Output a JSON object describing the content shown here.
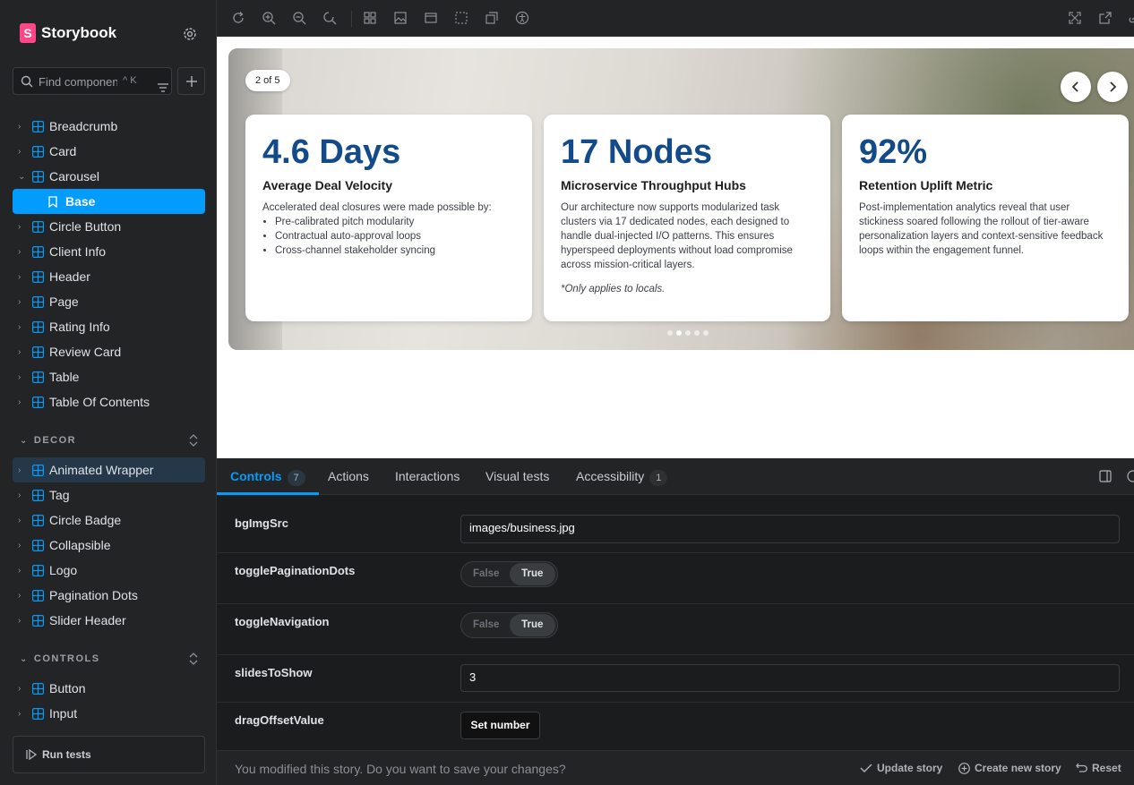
{
  "app": {
    "name": "Storybook"
  },
  "sidebar": {
    "search_placeholder": "Find components",
    "search_shortcut": "^ K",
    "components": [
      {
        "label": "Breadcrumb",
        "expanded": false
      },
      {
        "label": "Card",
        "expanded": false
      },
      {
        "label": "Carousel",
        "expanded": true
      },
      {
        "label": "Base",
        "story": true,
        "selected": true
      },
      {
        "label": "Circle Button",
        "expanded": false
      },
      {
        "label": "Client Info",
        "expanded": false
      },
      {
        "label": "Header",
        "expanded": false
      },
      {
        "label": "Page",
        "expanded": false
      },
      {
        "label": "Rating Info",
        "expanded": false
      },
      {
        "label": "Review Card",
        "expanded": false
      },
      {
        "label": "Table",
        "expanded": false
      },
      {
        "label": "Table Of Contents",
        "expanded": false
      }
    ],
    "decor_title": "DECOR",
    "decor": [
      {
        "label": "Animated Wrapper"
      },
      {
        "label": "Tag"
      },
      {
        "label": "Circle Badge"
      },
      {
        "label": "Collapsible"
      },
      {
        "label": "Logo"
      },
      {
        "label": "Pagination Dots"
      },
      {
        "label": "Slider Header"
      }
    ],
    "controls_title": "CONTROLS",
    "controls": [
      {
        "label": "Button"
      },
      {
        "label": "Input"
      }
    ],
    "run_tests_label": "Run tests"
  },
  "preview": {
    "counter": "2 of 5",
    "cards": [
      {
        "big": "4.6 Days",
        "title": "Average Deal Velocity",
        "desc": "Accelerated deal closures were made possible by:",
        "bullets": [
          "Pre-calibrated pitch modularity",
          "Contractual auto-approval loops",
          "Cross-channel stakeholder syncing"
        ]
      },
      {
        "big": "17 Nodes",
        "title": "Microservice Throughput Hubs",
        "desc": "Our architecture now supports modularized task clusters via 17 dedicated nodes, each designed to handle dual-injected I/O patterns. This ensures hyperspeed deployments without load compromise across mission-critical layers.",
        "note": "*Only applies to locals."
      },
      {
        "big": "92%",
        "title": "Retention Uplift Metric",
        "desc": "Post-implementation analytics reveal that user stickiness soared following the rollout of tier-aware personalization layers and context-sensitive feedback loops within the engagement funnel."
      }
    ],
    "dots_total": 5,
    "dots_active": 2
  },
  "panel": {
    "tabs": [
      {
        "label": "Controls",
        "badge": "7"
      },
      {
        "label": "Actions"
      },
      {
        "label": "Interactions"
      },
      {
        "label": "Visual tests"
      },
      {
        "label": "Accessibility",
        "badge": "1"
      }
    ],
    "controls": {
      "bgImgSrc": {
        "label": "bgImgSrc",
        "value": "images/business.jpg"
      },
      "togglePaginationDots": {
        "label": "togglePaginationDots",
        "false_label": "False",
        "true_label": "True"
      },
      "toggleNavigation": {
        "label": "toggleNavigation",
        "false_label": "False",
        "true_label": "True"
      },
      "slidesToShow": {
        "label": "slidesToShow",
        "value": "3"
      },
      "dragOffsetValue": {
        "label": "dragOffsetValue",
        "button_label": "Set number"
      }
    },
    "footer": {
      "message": "You modified this story. Do you want to save your changes?",
      "update_label": "Update story",
      "create_label": "Create new story",
      "reset_label": "Reset"
    }
  },
  "colors": {
    "accent": "#029cfd",
    "sidebar_bg": "#222425",
    "stat_blue": "#134a8a"
  }
}
